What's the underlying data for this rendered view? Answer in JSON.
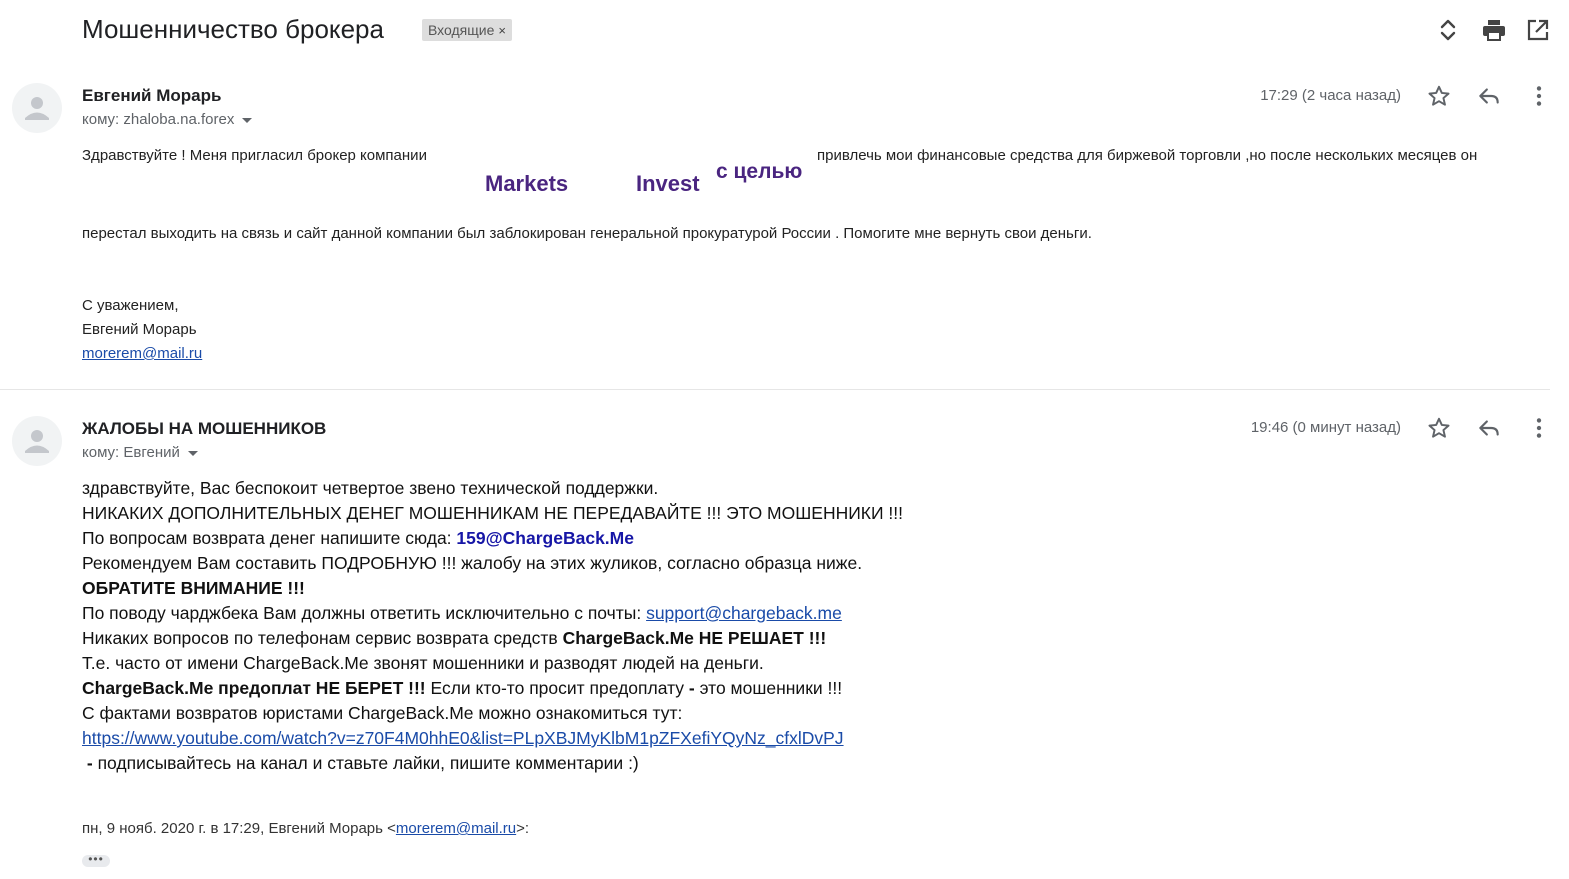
{
  "thread": {
    "subject": "Мошенничество брокера",
    "label": "Входящие",
    "label_close": "×"
  },
  "toolbar": {
    "icons": [
      "expand-collapse-icon",
      "print-icon",
      "open-new-window-icon"
    ]
  },
  "messages": [
    {
      "sender": "Евгений Морарь",
      "to_prefix": "кому:",
      "to": "zhaloba.na.forex",
      "time": "17:29 (2 часа назад)",
      "body": {
        "line1_a": "Здравствуйте ! Меня пригласил брокер компании",
        "line1_b": "привлечь мои   финансовые средства для биржевой торговли ,но после нескольких месяцев он",
        "word_markets": "Markets",
        "word_invest": "Invest",
        "word_goal": "с целью",
        "line2": "перестал выходить на связь и сайт данной компании был заблокирован генеральной  прокуратурой России . Помогите мне вернуть свои деньги.",
        "regards": "С уважением,",
        "name": "Евгений Морарь",
        "email": "morerem@mail.ru"
      }
    },
    {
      "sender": "ЖАЛОБЫ НА МОШЕННИКОВ",
      "to_prefix": "кому:",
      "to": "Евгений",
      "time": "19:46 (0 минут назад)",
      "body": {
        "l1": "здравствуйте, Вас беспокоит четвертое звено технической поддержки.",
        "l2": "НИКАКИХ ДОПОЛНИТЕЛЬНЫХ ДЕНЕГ МОШЕННИКАМ НЕ ПЕРЕДАВАЙТЕ !!! ЭТО МОШЕННИКИ !!!",
        "l3_a": "По вопросам возврата денег напишите сюда: ",
        "l3_b": "159@ChargeBack.Me",
        "l4": "Рекомендуем Вам составить ПОДРОБНУЮ !!! жалобу на этих жуликов, согласно образца ниже.",
        "l5": "ОБРАТИТЕ ВНИМАНИЕ !!!",
        "l6_a": "По поводу чарджбека Вам должны ответить исключительно с почты: ",
        "l6_b": "support@chargeback.me",
        "l7_a": "Никаких вопросов по телефонам сервис возврата средств ",
        "l7_b": "ChargeBack.Me НЕ РЕШАЕТ !!!",
        "l8": "Т.е. часто от имени ChargeBack.Me звонят мошенники и разводят людей на деньги.",
        "l9_a": "ChargeBack.Me предоплат НЕ БЕРЕТ !!!",
        "l9_b": " Если кто-то просит предоплату ",
        "l9_c": "-",
        "l9_d": " это мошенники !!!",
        "l10": "С фактами возвратов юристами ChargeBack.Me можно ознакомиться тут:",
        "l11": "https://www.youtube.com/watch?v=z70F4M0hhE0&list=PLpXBJMyKlbM1pZFXefiYQyNz_cfxlDvPJ",
        "l12_a": " - ",
        "l12_b": "подписывайтесь на канал и ставьте лайки, пишите комментарии :)"
      },
      "quote": {
        "prefix": "пн, 9 нояб. 2020 г. в 17:29, Евгений Морарь <",
        "email": "morerem@mail.ru",
        "suffix": ">:"
      },
      "trimmed": "•••"
    }
  ]
}
